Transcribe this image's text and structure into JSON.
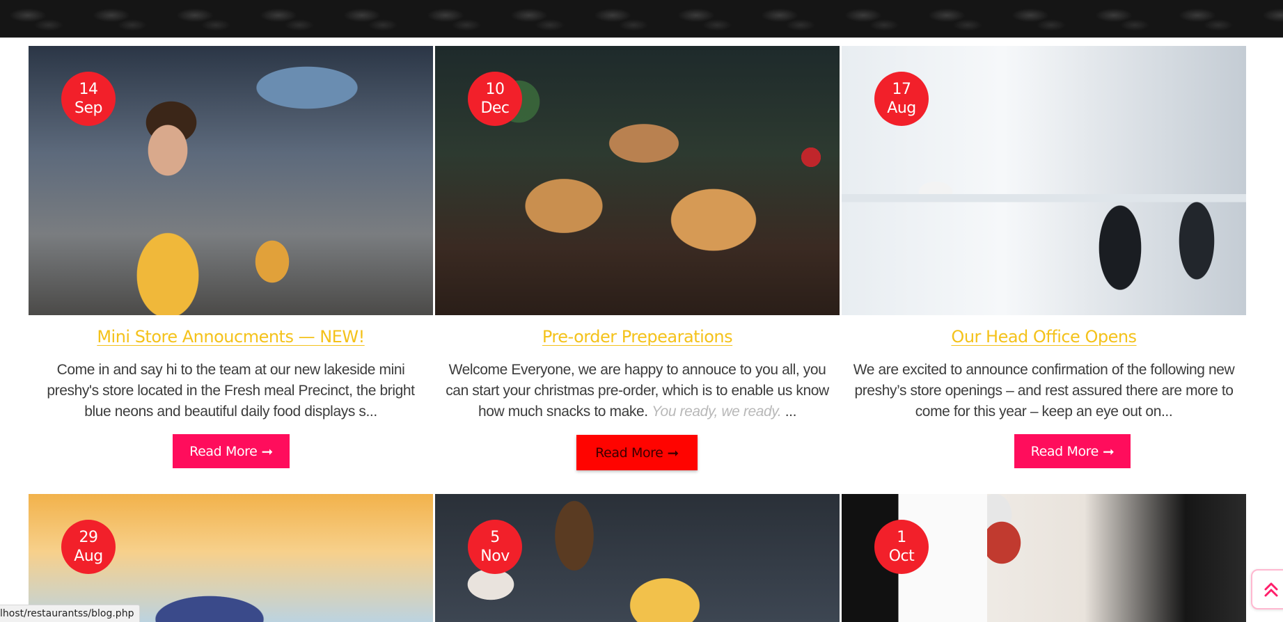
{
  "posts": [
    {
      "day": "14",
      "month": "Sep",
      "title": "Mini Store Annoucments — NEW!",
      "excerpt": "Come in and say hi to the team at our new lakeside mini preshy's store located in the Fresh meal Precinct, the bright blue neons and beautiful daily food displays s...",
      "read_more": "Read More"
    },
    {
      "day": "10",
      "month": "Dec",
      "title": "Pre-order Prepearations",
      "excerpt": "Welcome Everyone, we are happy to annouce to you all, you can start your christmas pre-order, which is to enable us know how much snacks to make.",
      "excerpt_italic": "You ready, we ready.",
      "excerpt_tail": " ...",
      "read_more": "Read More"
    },
    {
      "day": "17",
      "month": "Aug",
      "title": "Our Head Office Opens",
      "excerpt": "We are excited to announce confirmation of the following new preshy’s store openings – and rest assured there are more to come for this year – keep an eye out on...",
      "read_more": "Read More"
    },
    {
      "day": "29",
      "month": "Aug"
    },
    {
      "day": "5",
      "month": "Nov"
    },
    {
      "day": "1",
      "month": "Oct"
    }
  ],
  "status_url": "lhost/restaurantss/blog.php",
  "colors": {
    "accent_title": "#f4c21b",
    "date_badge": "#f2202a",
    "button": "#ff0d5c",
    "button_active": "#ff0400"
  },
  "icons": {
    "arrow": "long-arrow-right-icon",
    "scroll_top": "double-chevron-up-icon"
  }
}
